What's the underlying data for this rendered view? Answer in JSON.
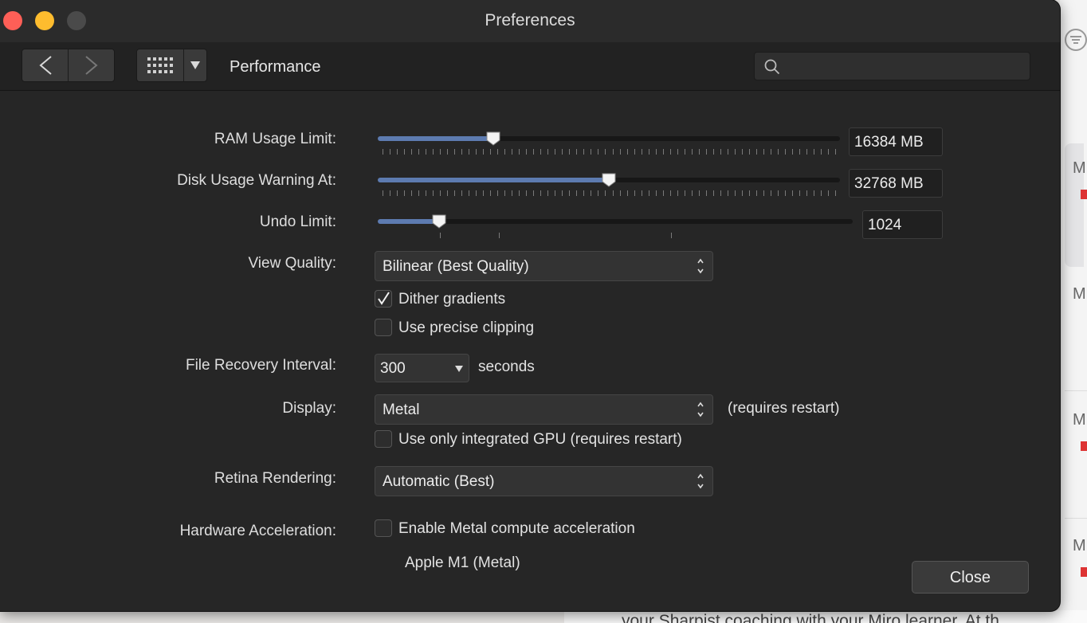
{
  "window": {
    "title": "Preferences"
  },
  "toolbar": {
    "section_title": "Performance",
    "search_placeholder": ""
  },
  "ram": {
    "label": "RAM Usage Limit:",
    "value": "16384 MB",
    "fraction": 0.25
  },
  "disk": {
    "label": "Disk Usage Warning At:",
    "value": "32768 MB",
    "fraction": 0.5
  },
  "undo": {
    "label": "Undo Limit:",
    "value": "1024",
    "fraction": 0.13
  },
  "view_quality": {
    "label": "View Quality:",
    "selected": "Bilinear (Best Quality)",
    "dither_label": "Dither gradients",
    "dither_checked": true,
    "clipping_label": "Use precise clipping",
    "clipping_checked": false
  },
  "recovery": {
    "label": "File Recovery Interval:",
    "value": "300",
    "unit": "seconds"
  },
  "display": {
    "label": "Display:",
    "selected": "Metal",
    "note": "(requires restart)",
    "gpu_label": "Use only integrated GPU (requires restart)",
    "gpu_checked": false
  },
  "retina": {
    "label": "Retina Rendering:",
    "selected": "Automatic (Best)"
  },
  "hardware": {
    "label": "Hardware Acceleration:",
    "metal_label": "Enable Metal compute acceleration",
    "metal_checked": false,
    "device": "Apple M1 (Metal)"
  },
  "buttons": {
    "close": "Close"
  },
  "colors": {
    "accent": "#5d7bb0",
    "window_bg": "#262626",
    "close_red": "#fe5f57",
    "minimize_yellow": "#febc2e"
  },
  "background_app": {
    "letter": "M",
    "snippet": "your Sharpist coaching with your Miro learner. At th"
  }
}
